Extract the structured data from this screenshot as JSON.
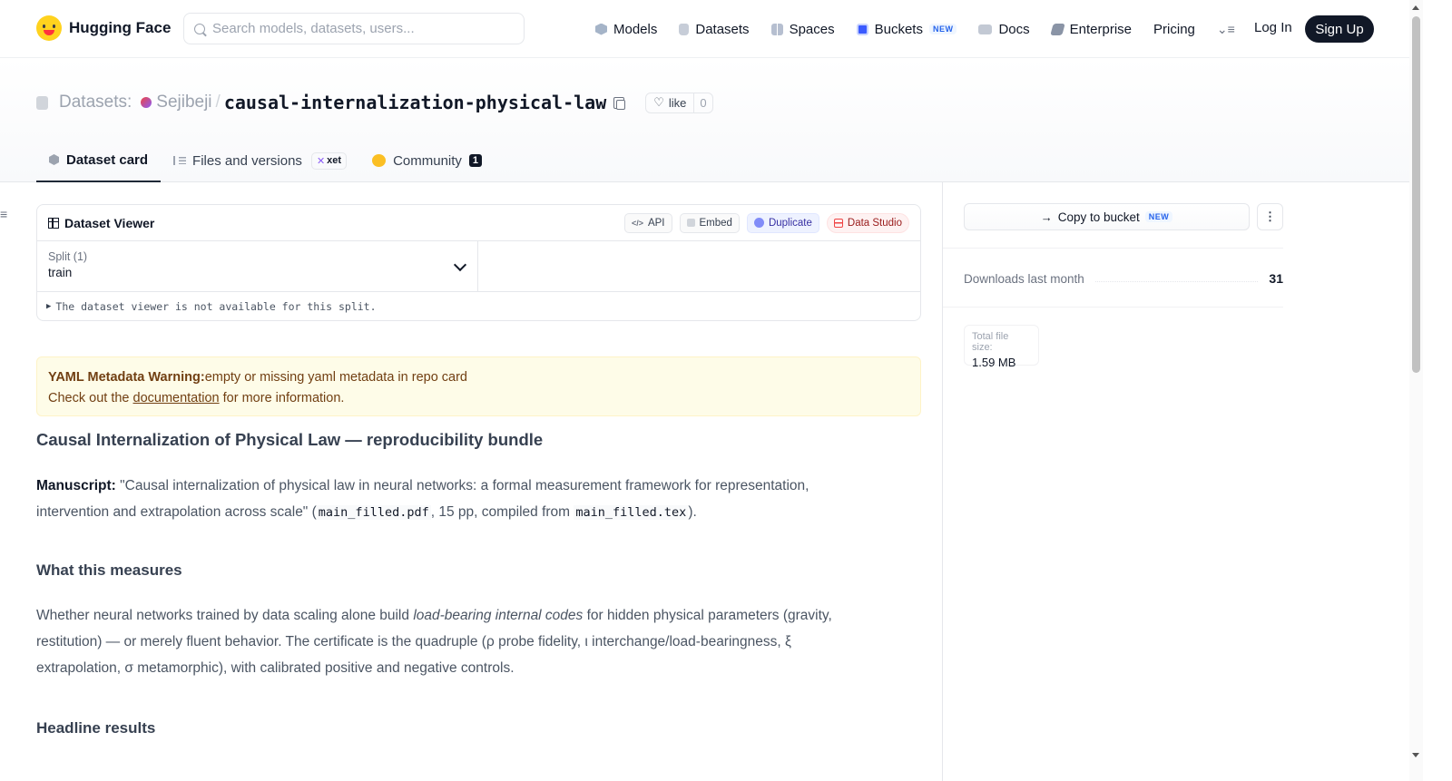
{
  "nav": {
    "brand": "Hugging Face",
    "search_placeholder": "Search models, datasets, users...",
    "links": [
      {
        "label": "Models",
        "icon": "models-icon"
      },
      {
        "label": "Datasets",
        "icon": "datasets-icon"
      },
      {
        "label": "Spaces",
        "icon": "spaces-icon"
      },
      {
        "label": "Buckets",
        "icon": "buckets-icon",
        "badge": "NEW"
      },
      {
        "label": "Docs",
        "icon": "docs-icon"
      },
      {
        "label": "Enterprise",
        "icon": "enterprise-icon"
      },
      {
        "label": "Pricing"
      }
    ],
    "login": "Log In",
    "signup": "Sign Up"
  },
  "repo": {
    "type_label": "Datasets:",
    "owner": "Sejibeji",
    "separator": "/",
    "name": "causal-internalization-physical-law",
    "like_label": "like",
    "like_count": "0"
  },
  "tabs": [
    {
      "label": "Dataset card",
      "active": true
    },
    {
      "label": "Files and versions",
      "badge": "xet"
    },
    {
      "label": "Community",
      "count": "1"
    }
  ],
  "viewer": {
    "title": "Dataset Viewer",
    "actions": [
      "API",
      "Embed",
      "Duplicate",
      "Data Studio"
    ],
    "split_label": "Split (1)",
    "split_value": "train",
    "unavailable": "The dataset viewer is not available for this split."
  },
  "warning": {
    "title": "YAML Metadata Warning:",
    "message": "empty or missing yaml metadata in repo card",
    "line2_pre": "Check out the ",
    "link": "documentation",
    "line2_post": " for more information."
  },
  "card": {
    "title": "Causal Internalization of Physical Law — reproducibility bundle",
    "manuscript_label": "Manuscript:",
    "manuscript_text_1": " \"Causal internalization of physical law in neural networks: a formal measurement framework for representation, intervention and extrapolation across scale\" (",
    "manuscript_pdf": "main_filled.pdf",
    "manuscript_text_2": ", 15 pp, compiled from ",
    "manuscript_tex": "main_filled.tex",
    "manuscript_text_3": ").",
    "section_measures": "What this measures",
    "measures_text_1": "Whether neural networks trained by data scaling alone build ",
    "measures_em": "load-bearing internal codes",
    "measures_text_2": " for hidden physical parameters (gravity, restitution) — or merely fluent behavior. The certificate is the quadruple (ρ probe fidelity, ι interchange/load-bearingness, ξ extrapolation, σ metamorphic), with calibrated positive and negative controls.",
    "section_results": "Headline results"
  },
  "sidebar": {
    "copy_bucket": "Copy to bucket",
    "copy_bucket_badge": "NEW",
    "downloads_label": "Downloads last month",
    "downloads_count": "31",
    "filesize_label": "Total file size:",
    "filesize_value": "1.59 MB"
  },
  "colors": {
    "brand_yellow": "#ffd21e",
    "primary_dark": "#111827",
    "warning_bg": "#fefce8",
    "new_badge": "#2563eb"
  }
}
